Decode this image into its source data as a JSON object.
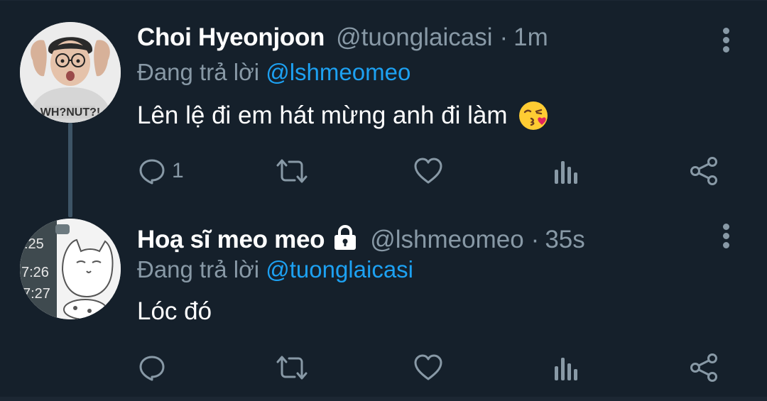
{
  "colors": {
    "background": "#15202b",
    "primary_text": "#ffffff",
    "secondary_text": "#8899a6",
    "accent": "#1da1f2",
    "thread_line": "#3d5466"
  },
  "tweets": [
    {
      "name": "Choi Hyeonjoon",
      "handle": "@tuonglaicasi",
      "separator": "·",
      "time": "1m",
      "replying_prefix": "Đang trả lời",
      "replying_to": "@lshmeomeo",
      "text": "Lên lệ đi em hát mừng anh đi làm",
      "emoji": "face-throwing-kiss-icon",
      "reply_count": "1",
      "protected": false,
      "avatar": "user-avatar-photo"
    },
    {
      "name": "Hoạ sĩ meo meo",
      "handle": "@lshmeomeo",
      "separator": "·",
      "time": "35s",
      "replying_prefix": "Đang trả lời",
      "replying_to": "@tuonglaicasi",
      "text": "Lóc đó",
      "reply_count": "",
      "protected": true,
      "avatar": "cat-drawing-avatar"
    }
  ],
  "icons": {
    "reply": "reply-icon",
    "retweet": "retweet-icon",
    "like": "heart-icon",
    "analytics": "analytics-icon",
    "share": "share-icon",
    "more": "more-vertical-icon",
    "lock": "lock-icon"
  }
}
